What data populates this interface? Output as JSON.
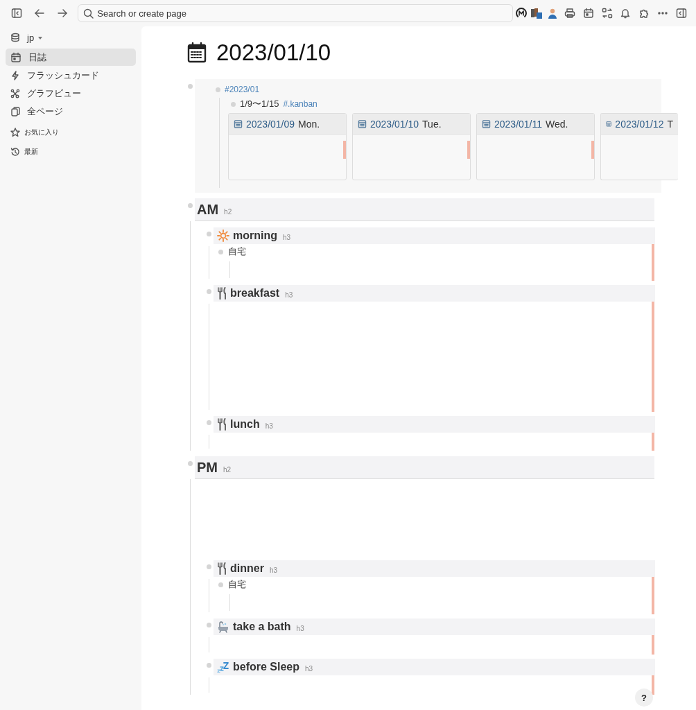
{
  "toolbar": {
    "search": {
      "placeholder": "Search or create page"
    }
  },
  "sidebar": {
    "graph": "jp",
    "nav": [
      {
        "label": "日誌",
        "selected": true
      },
      {
        "label": "フラッシュカード",
        "selected": false
      },
      {
        "label": "グラフビュー",
        "selected": false
      },
      {
        "label": "全ページ",
        "selected": false
      }
    ],
    "sections": [
      "お気に入り",
      "最新"
    ]
  },
  "page": {
    "title": "2023/01/10",
    "intro": {
      "tag": "#2023/01",
      "child": {
        "text": "1/9〜1/15",
        "tag": "#.kanban",
        "cards": [
          {
            "date": "2023/01/09",
            "day": "Mon."
          },
          {
            "date": "2023/01/10",
            "day": "Tue."
          },
          {
            "date": "2023/01/11",
            "day": "Wed."
          },
          {
            "date": "2023/01/12",
            "day": "T"
          }
        ]
      }
    },
    "sections": [
      {
        "heading": "AM",
        "level": "h2",
        "items": [
          {
            "kind": "sun",
            "heading": "morning",
            "level": "h3",
            "lines": [
              "自宅"
            ]
          },
          {
            "kind": "meal",
            "heading": "breakfast",
            "level": "h3"
          },
          {
            "kind": "meal",
            "heading": "lunch",
            "level": "h3"
          }
        ]
      },
      {
        "heading": "PM",
        "level": "h2",
        "items": [
          {
            "kind": "meal",
            "heading": "dinner",
            "level": "h3",
            "lines": [
              "自宅"
            ]
          },
          {
            "kind": "bath",
            "heading": "take a bath",
            "level": "h3"
          },
          {
            "kind": "sleep",
            "heading": "before Sleep",
            "level": "h3"
          }
        ]
      }
    ]
  },
  "help": "?"
}
